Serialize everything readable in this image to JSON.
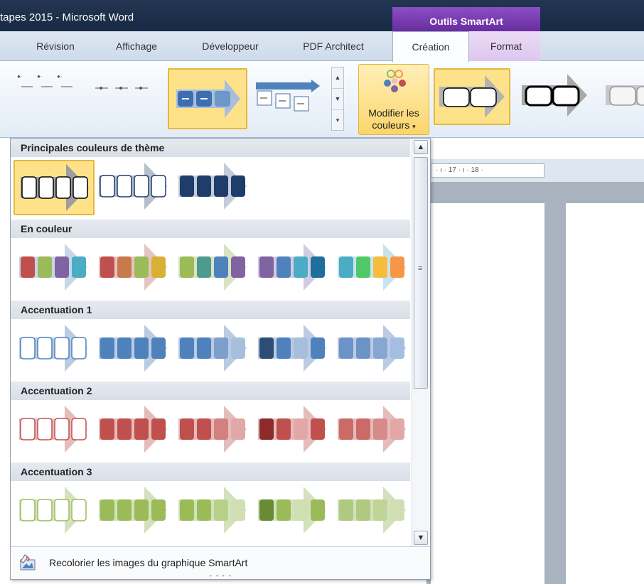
{
  "window": {
    "title": "tapes 2015  -  Microsoft Word",
    "context_tab_group": "Outils SmartArt"
  },
  "tabs": [
    {
      "label": "Révision"
    },
    {
      "label": "Affichage"
    },
    {
      "label": "Développeur"
    },
    {
      "label": "PDF Architect"
    },
    {
      "label": "Création",
      "active": true
    },
    {
      "label": "Format"
    }
  ],
  "ribbon": {
    "change_colors_line1": "Modifier les",
    "change_colors_line2": "couleurs"
  },
  "ruler": {
    "text": "· ı · 17 · ı · 18 ·"
  },
  "dropdown": {
    "sections": [
      {
        "title": "Principales couleurs de thème",
        "swatches": [
          {
            "name": "Sombre 1 contour",
            "style": "outline",
            "colors": [
              "#000000",
              "#000000",
              "#000000",
              "#000000"
            ],
            "arrow": "#9e9e9e",
            "selected": true
          },
          {
            "name": "Sombre 2 contour",
            "style": "outline",
            "colors": [
              "#1f3c6a",
              "#1f3c6a",
              "#1f3c6a",
              "#1f3c6a"
            ],
            "arrow": "#b5bfcd"
          },
          {
            "name": "Sombre 2 rempli",
            "style": "fill",
            "colors": [
              "#1f3c6a",
              "#1f3c6a",
              "#1f3c6a",
              "#1f3c6a"
            ],
            "arrow": "#c4ccd9"
          }
        ]
      },
      {
        "title": "En couleur",
        "swatches": [
          {
            "style": "fill",
            "colors": [
              "#c0504d",
              "#9bbb59",
              "#8064a2",
              "#4bacc6"
            ],
            "arrow": "#c9d6e8"
          },
          {
            "style": "fill",
            "colors": [
              "#c0504d",
              "#c77a4b",
              "#9bbb59",
              "#d8b034"
            ],
            "arrow": "#e7c3c3"
          },
          {
            "style": "fill",
            "colors": [
              "#9bbb59",
              "#4e9a8e",
              "#4f81bd",
              "#8064a2"
            ],
            "arrow": "#d8e4c3"
          },
          {
            "style": "fill",
            "colors": [
              "#8064a2",
              "#4f81bd",
              "#4bacc6",
              "#1f6e9c"
            ],
            "arrow": "#d3cbe1"
          },
          {
            "style": "fill",
            "colors": [
              "#4bacc6",
              "#4fc86a",
              "#f7bd3a",
              "#f79646"
            ],
            "arrow": "#c8e3ec"
          }
        ]
      },
      {
        "title": "Accentuation 1",
        "swatches": [
          {
            "style": "outline",
            "colors": [
              "#4f81bd",
              "#4f81bd",
              "#4f81bd",
              "#4f81bd"
            ],
            "arrow": "#bacbe2"
          },
          {
            "style": "fill",
            "colors": [
              "#4f81bd",
              "#4f81bd",
              "#4f81bd",
              "#4f81bd"
            ],
            "arrow": "#bacbe2"
          },
          {
            "style": "fill",
            "colors": [
              "#4f81bd",
              "#4f81bd",
              "#7d9fcb",
              "#a8bfdc"
            ],
            "arrow": "#bacbe2"
          },
          {
            "style": "fill",
            "colors": [
              "#2c4d75",
              "#4f81bd",
              "#a8bfdc",
              "#4f81bd"
            ],
            "arrow": "#bacbe2"
          },
          {
            "style": "fill",
            "colors": [
              "#6c93c7",
              "#6c93c7",
              "#86a7d2",
              "#a5bde0"
            ],
            "arrow": "#bacbe2"
          }
        ]
      },
      {
        "title": "Accentuation 2",
        "swatches": [
          {
            "style": "outline",
            "colors": [
              "#c0504d",
              "#c0504d",
              "#c0504d",
              "#c0504d"
            ],
            "arrow": "#e4bcbb"
          },
          {
            "style": "fill",
            "colors": [
              "#c0504d",
              "#c0504d",
              "#c0504d",
              "#c0504d"
            ],
            "arrow": "#e4bcbb"
          },
          {
            "style": "fill",
            "colors": [
              "#c0504d",
              "#c0504d",
              "#d3807e",
              "#e2a8a7"
            ],
            "arrow": "#e4bcbb"
          },
          {
            "style": "fill",
            "colors": [
              "#8c2b29",
              "#c0504d",
              "#e2a8a7",
              "#c0504d"
            ],
            "arrow": "#e4bcbb"
          },
          {
            "style": "fill",
            "colors": [
              "#cc6a68",
              "#cc6a68",
              "#d78a88",
              "#e3a8a6"
            ],
            "arrow": "#e4bcbb"
          }
        ]
      },
      {
        "title": "Accentuation 3",
        "swatches": [
          {
            "style": "outline",
            "colors": [
              "#9bbb59",
              "#9bbb59",
              "#9bbb59",
              "#9bbb59"
            ],
            "arrow": "#d3e2bc"
          },
          {
            "style": "fill",
            "colors": [
              "#9bbb59",
              "#9bbb59",
              "#9bbb59",
              "#9bbb59"
            ],
            "arrow": "#d3e2bc"
          },
          {
            "style": "fill",
            "colors": [
              "#9bbb59",
              "#9bbb59",
              "#b8cf8a",
              "#cfdfb1"
            ],
            "arrow": "#d3e2bc"
          },
          {
            "style": "fill",
            "colors": [
              "#6b8a36",
              "#9bbb59",
              "#cfdfb1",
              "#9bbb59"
            ],
            "arrow": "#d3e2bc"
          },
          {
            "style": "fill",
            "colors": [
              "#b0c980",
              "#b0c980",
              "#bfd496",
              "#cfdfb1"
            ],
            "arrow": "#d3e2bc"
          }
        ]
      }
    ],
    "footer": {
      "recolor_label": "Recolorier les images du graphique SmartArt"
    }
  }
}
